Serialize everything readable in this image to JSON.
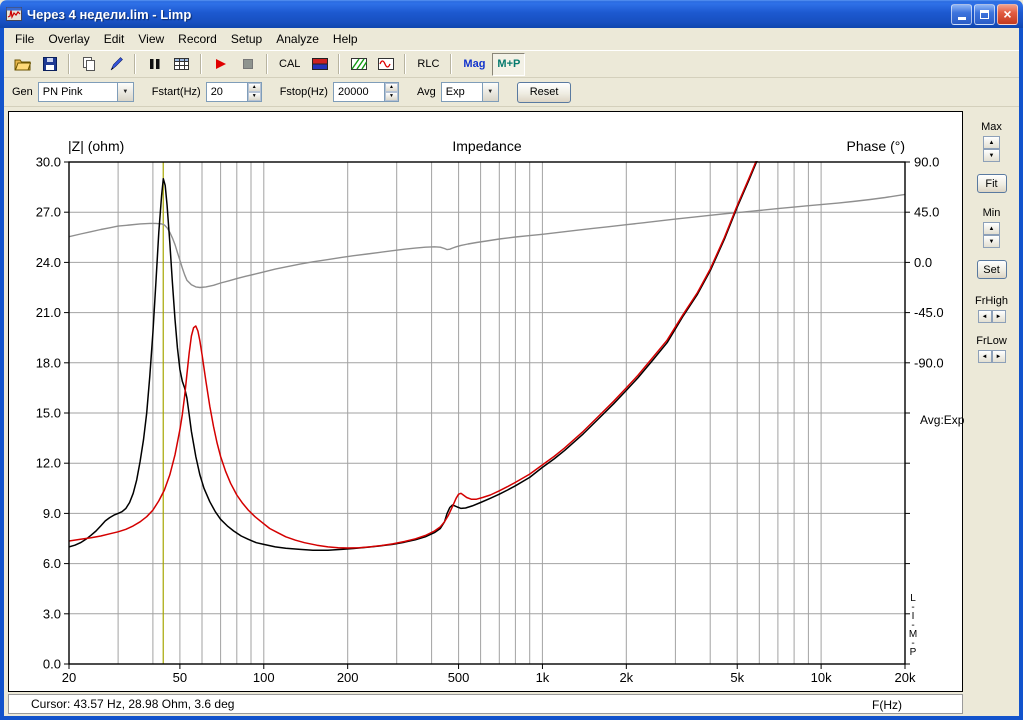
{
  "window": {
    "title": "Через 4 недели.lim - Limp"
  },
  "menu": {
    "items": [
      "File",
      "Overlay",
      "Edit",
      "View",
      "Record",
      "Setup",
      "Analyze",
      "Help"
    ]
  },
  "toolbar": {
    "cal_label": "CAL",
    "rlc_label": "RLC",
    "mag_label": "Mag",
    "mp_label": "M+P"
  },
  "controls": {
    "gen_label": "Gen",
    "gen_value": "PN Pink",
    "fstart_label": "Fstart(Hz)",
    "fstart_value": "20",
    "fstop_label": "Fstop(Hz)",
    "fstop_value": "20000",
    "avg_label": "Avg",
    "avg_value": "Exp",
    "reset_label": "Reset"
  },
  "side_panel": {
    "max_label": "Max",
    "fit_label": "Fit",
    "min_label": "Min",
    "set_label": "Set",
    "frhigh_label": "FrHigh",
    "frlow_label": "FrLow"
  },
  "chart_overlay": {
    "avg_text": "Avg:Exp",
    "limp_vertical": "L\n-\nI\n-\nM\n-\nP"
  },
  "status": {
    "cursor_text": "Cursor: 43.57 Hz, 28.98 Ohm, 3.6 deg",
    "xaxis_label": "F(Hz)"
  },
  "chart_data": {
    "type": "line",
    "title": "Impedance",
    "x_axis": {
      "label": "F(Hz)",
      "scale": "log",
      "min": 20,
      "max": 20000,
      "tick_labels": [
        [
          20,
          "20"
        ],
        [
          50,
          "50"
        ],
        [
          100,
          "100"
        ],
        [
          200,
          "200"
        ],
        [
          500,
          "500"
        ],
        [
          1000,
          "1k"
        ],
        [
          2000,
          "2k"
        ],
        [
          5000,
          "5k"
        ],
        [
          10000,
          "10k"
        ],
        [
          20000,
          "20k"
        ]
      ]
    },
    "y_left": {
      "label": "|Z| (ohm)",
      "min": 0,
      "max": 30,
      "step": 3
    },
    "y_right": {
      "label": "Phase (°)",
      "zero_at_left": 24,
      "deg_per_left_unit": 15,
      "labels": [
        [
          90,
          "90.0"
        ],
        [
          45,
          "45.0"
        ],
        [
          0,
          "0.0"
        ],
        [
          -45,
          "-45.0"
        ],
        [
          -90,
          "-90.0"
        ]
      ]
    },
    "cursor": {
      "freq_hz": 43.57,
      "z_ohm": 28.98,
      "phase_deg": 3.6,
      "line_color": "#a6a600"
    },
    "series": [
      {
        "name": "phase-gray",
        "color": "#8f8f8f",
        "width": 1.4,
        "unit": "deg",
        "points": [
          [
            20,
            23
          ],
          [
            22,
            25.5
          ],
          [
            24,
            27.5
          ],
          [
            26,
            29.5
          ],
          [
            28,
            31
          ],
          [
            30,
            32.5
          ],
          [
            33,
            33.5
          ],
          [
            36,
            34.5
          ],
          [
            39,
            35
          ],
          [
            41,
            35
          ],
          [
            43,
            34.5
          ],
          [
            44,
            33.5
          ],
          [
            45,
            31
          ],
          [
            46,
            27
          ],
          [
            47,
            22
          ],
          [
            48,
            16
          ],
          [
            49,
            9
          ],
          [
            50,
            2
          ],
          [
            51,
            -5
          ],
          [
            52,
            -11
          ],
          [
            53,
            -16
          ],
          [
            55,
            -20
          ],
          [
            57,
            -22
          ],
          [
            59,
            -22.5
          ],
          [
            62,
            -22
          ],
          [
            66,
            -20.5
          ],
          [
            70,
            -18.5
          ],
          [
            75,
            -16.5
          ],
          [
            80,
            -14.5
          ],
          [
            86,
            -12.5
          ],
          [
            93,
            -10.5
          ],
          [
            100,
            -8.5
          ],
          [
            110,
            -6
          ],
          [
            120,
            -4
          ],
          [
            135,
            -1.5
          ],
          [
            150,
            0.5
          ],
          [
            170,
            2.5
          ],
          [
            190,
            4.5
          ],
          [
            210,
            6
          ],
          [
            235,
            7.5
          ],
          [
            260,
            9
          ],
          [
            290,
            10.5
          ],
          [
            320,
            11.8
          ],
          [
            350,
            12.8
          ],
          [
            380,
            13.6
          ],
          [
            410,
            14
          ],
          [
            430,
            13.6
          ],
          [
            445,
            12.5
          ],
          [
            455,
            11.5
          ],
          [
            465,
            11.8
          ],
          [
            475,
            12.8
          ],
          [
            490,
            14
          ],
          [
            510,
            15.2
          ],
          [
            540,
            16.5
          ],
          [
            580,
            17.8
          ],
          [
            630,
            19.2
          ],
          [
            700,
            21
          ],
          [
            800,
            22.8
          ],
          [
            900,
            24
          ],
          [
            1000,
            25.2
          ],
          [
            1150,
            27
          ],
          [
            1300,
            28.5
          ],
          [
            1500,
            30.3
          ],
          [
            1700,
            31.8
          ],
          [
            2000,
            33.8
          ],
          [
            2300,
            35.5
          ],
          [
            2600,
            37
          ],
          [
            3000,
            38.8
          ],
          [
            3500,
            40.6
          ],
          [
            4000,
            42.2
          ],
          [
            4600,
            43.8
          ],
          [
            5200,
            45
          ],
          [
            6000,
            46.5
          ],
          [
            7000,
            48.2
          ],
          [
            8000,
            49.6
          ],
          [
            9000,
            50.8
          ],
          [
            10000,
            51.8
          ],
          [
            11500,
            53.2
          ],
          [
            13000,
            54.6
          ],
          [
            15000,
            56.4
          ],
          [
            17000,
            58.2
          ],
          [
            20000,
            61
          ]
        ]
      },
      {
        "name": "impedance-black",
        "color": "#000000",
        "width": 1.5,
        "unit": "ohm",
        "points": [
          [
            20,
            7.0
          ],
          [
            21,
            7.1
          ],
          [
            22,
            7.25
          ],
          [
            23,
            7.45
          ],
          [
            24,
            7.7
          ],
          [
            25,
            7.95
          ],
          [
            26,
            8.25
          ],
          [
            27,
            8.55
          ],
          [
            28,
            8.75
          ],
          [
            29,
            8.9
          ],
          [
            30,
            9.0
          ],
          [
            31,
            9.1
          ],
          [
            32,
            9.3
          ],
          [
            33,
            9.65
          ],
          [
            34,
            10.2
          ],
          [
            35,
            11.0
          ],
          [
            36,
            12.1
          ],
          [
            37,
            13.4
          ],
          [
            38,
            15.0
          ],
          [
            39,
            17.2
          ],
          [
            40,
            19.8
          ],
          [
            41,
            22.8
          ],
          [
            42,
            25.8
          ],
          [
            43,
            28.0
          ],
          [
            43.6,
            29.0
          ],
          [
            44.3,
            28.6
          ],
          [
            45,
            27.4
          ],
          [
            46,
            25.2
          ],
          [
            47,
            22.8
          ],
          [
            48,
            20.6
          ],
          [
            49,
            18.9
          ],
          [
            50,
            17.6
          ],
          [
            51,
            16.9
          ],
          [
            52,
            16.5
          ],
          [
            53,
            15.9
          ],
          [
            54,
            14.9
          ],
          [
            55,
            13.9
          ],
          [
            57,
            12.4
          ],
          [
            59,
            11.3
          ],
          [
            61,
            10.5
          ],
          [
            64,
            9.7
          ],
          [
            67,
            9.1
          ],
          [
            70,
            8.65
          ],
          [
            74,
            8.25
          ],
          [
            78,
            7.95
          ],
          [
            83,
            7.65
          ],
          [
            88,
            7.45
          ],
          [
            94,
            7.25
          ],
          [
            100,
            7.15
          ],
          [
            110,
            7.0
          ],
          [
            120,
            6.92
          ],
          [
            135,
            6.85
          ],
          [
            150,
            6.8
          ],
          [
            170,
            6.8
          ],
          [
            190,
            6.85
          ],
          [
            210,
            6.9
          ],
          [
            235,
            6.98
          ],
          [
            260,
            7.05
          ],
          [
            290,
            7.15
          ],
          [
            320,
            7.28
          ],
          [
            350,
            7.42
          ],
          [
            380,
            7.6
          ],
          [
            410,
            7.85
          ],
          [
            430,
            8.1
          ],
          [
            445,
            8.5
          ],
          [
            455,
            9.0
          ],
          [
            465,
            9.35
          ],
          [
            475,
            9.5
          ],
          [
            485,
            9.45
          ],
          [
            495,
            9.38
          ],
          [
            510,
            9.3
          ],
          [
            530,
            9.32
          ],
          [
            560,
            9.45
          ],
          [
            600,
            9.65
          ],
          [
            650,
            9.9
          ],
          [
            700,
            10.15
          ],
          [
            750,
            10.4
          ],
          [
            800,
            10.65
          ],
          [
            900,
            11.15
          ],
          [
            1000,
            11.75
          ],
          [
            1100,
            12.25
          ],
          [
            1200,
            12.75
          ],
          [
            1400,
            13.75
          ],
          [
            1600,
            14.7
          ],
          [
            1800,
            15.55
          ],
          [
            2000,
            16.35
          ],
          [
            2200,
            17.1
          ],
          [
            2500,
            18.2
          ],
          [
            2800,
            19.2
          ],
          [
            3200,
            20.8
          ],
          [
            3600,
            22.1
          ],
          [
            4000,
            23.5
          ],
          [
            4500,
            25.4
          ],
          [
            5000,
            27.3
          ],
          [
            5500,
            28.9
          ],
          [
            6000,
            30.4
          ]
        ]
      },
      {
        "name": "impedance-red",
        "color": "#d40000",
        "width": 1.5,
        "unit": "ohm",
        "points": [
          [
            20,
            7.35
          ],
          [
            22,
            7.45
          ],
          [
            24,
            7.55
          ],
          [
            26,
            7.65
          ],
          [
            28,
            7.78
          ],
          [
            30,
            7.9
          ],
          [
            32,
            8.05
          ],
          [
            34,
            8.25
          ],
          [
            36,
            8.5
          ],
          [
            38,
            8.8
          ],
          [
            40,
            9.2
          ],
          [
            42,
            9.75
          ],
          [
            44,
            10.4
          ],
          [
            46,
            11.3
          ],
          [
            48,
            12.5
          ],
          [
            50,
            14.0
          ],
          [
            51,
            14.9
          ],
          [
            52,
            16.0
          ],
          [
            53,
            17.3
          ],
          [
            54,
            18.6
          ],
          [
            55,
            19.6
          ],
          [
            56,
            20.1
          ],
          [
            57,
            20.2
          ],
          [
            58,
            19.9
          ],
          [
            59,
            19.3
          ],
          [
            60,
            18.5
          ],
          [
            62,
            16.9
          ],
          [
            64,
            15.4
          ],
          [
            66,
            14.2
          ],
          [
            68,
            13.2
          ],
          [
            70,
            12.4
          ],
          [
            73,
            11.5
          ],
          [
            76,
            10.8
          ],
          [
            80,
            10.1
          ],
          [
            84,
            9.6
          ],
          [
            88,
            9.2
          ],
          [
            93,
            8.8
          ],
          [
            98,
            8.5
          ],
          [
            105,
            8.1
          ],
          [
            112,
            7.85
          ],
          [
            120,
            7.6
          ],
          [
            130,
            7.4
          ],
          [
            140,
            7.25
          ],
          [
            155,
            7.1
          ],
          [
            170,
            7.0
          ],
          [
            185,
            6.95
          ],
          [
            200,
            6.93
          ],
          [
            220,
            6.95
          ],
          [
            240,
            7.0
          ],
          [
            265,
            7.08
          ],
          [
            290,
            7.18
          ],
          [
            320,
            7.32
          ],
          [
            350,
            7.48
          ],
          [
            380,
            7.68
          ],
          [
            410,
            7.95
          ],
          [
            430,
            8.2
          ],
          [
            445,
            8.5
          ],
          [
            460,
            8.9
          ],
          [
            475,
            9.4
          ],
          [
            490,
            9.9
          ],
          [
            500,
            10.15
          ],
          [
            510,
            10.2
          ],
          [
            520,
            10.1
          ],
          [
            535,
            9.95
          ],
          [
            555,
            9.85
          ],
          [
            580,
            9.85
          ],
          [
            610,
            9.95
          ],
          [
            650,
            10.1
          ],
          [
            700,
            10.35
          ],
          [
            750,
            10.6
          ],
          [
            800,
            10.85
          ],
          [
            900,
            11.35
          ],
          [
            1000,
            11.9
          ],
          [
            1100,
            12.4
          ],
          [
            1200,
            12.9
          ],
          [
            1400,
            13.9
          ],
          [
            1600,
            14.85
          ],
          [
            1800,
            15.7
          ],
          [
            2000,
            16.5
          ],
          [
            2200,
            17.25
          ],
          [
            2500,
            18.35
          ],
          [
            2800,
            19.35
          ],
          [
            3200,
            20.9
          ],
          [
            3600,
            22.2
          ],
          [
            4000,
            23.6
          ],
          [
            4500,
            25.5
          ],
          [
            5000,
            27.4
          ],
          [
            5500,
            29.0
          ],
          [
            6000,
            30.5
          ]
        ]
      }
    ]
  }
}
